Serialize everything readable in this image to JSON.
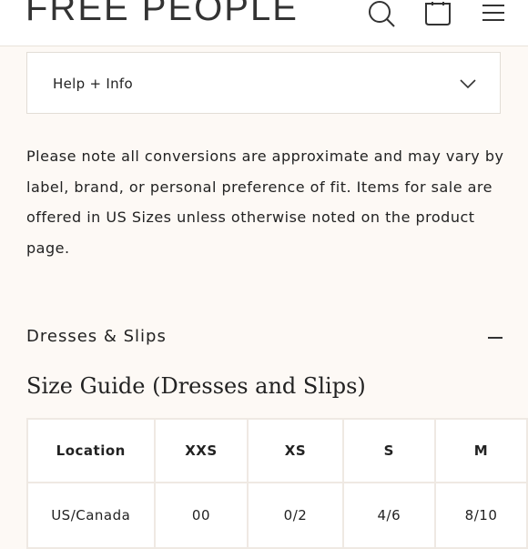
{
  "header": {
    "logo": "FREE PEOPLE",
    "icons": [
      "search-icon",
      "bag-icon",
      "menu-icon"
    ]
  },
  "help": {
    "label": "Help + Info"
  },
  "note": "Please note all conversions are approximate and may vary by label, brand, or personal preference of fit. Items for sale are offered in US Sizes unless otherwise noted on the product page.",
  "section": {
    "title": "Dresses & Slips"
  },
  "size_guide": {
    "heading": "Size Guide (Dresses and Slips)",
    "columns": [
      "Location",
      "XXS",
      "XS",
      "S",
      "M"
    ],
    "rows": [
      [
        "US/Canada",
        "00",
        "0/2",
        "4/6",
        "8/10"
      ]
    ]
  },
  "colors": {
    "background": "#fdf9f5",
    "border": "#efe9e3",
    "text": "#222222"
  }
}
